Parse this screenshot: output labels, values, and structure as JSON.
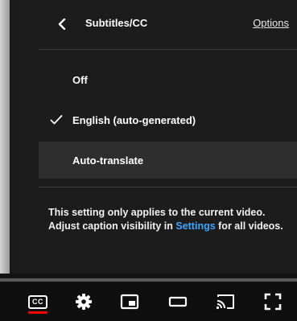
{
  "panel": {
    "title": "Subtitles/CC",
    "options_link": "Options",
    "items": [
      {
        "label": "Off",
        "selected": false
      },
      {
        "label": "English (auto-generated)",
        "selected": true
      },
      {
        "label": "Auto-translate",
        "selected": false
      }
    ],
    "info_prefix": "This setting only applies to the current video. Adjust caption visibility in ",
    "info_link": "Settings",
    "info_suffix": " for all videos."
  },
  "controls": {
    "cc_label": "CC",
    "icons": [
      "cc-icon",
      "gear-icon",
      "miniplayer-icon",
      "theater-mode-icon",
      "cast-icon",
      "fullscreen-icon"
    ]
  },
  "colors": {
    "link": "#3ea6ff",
    "accent": "#ff0000",
    "panel_bg": "#1c1c1c"
  }
}
